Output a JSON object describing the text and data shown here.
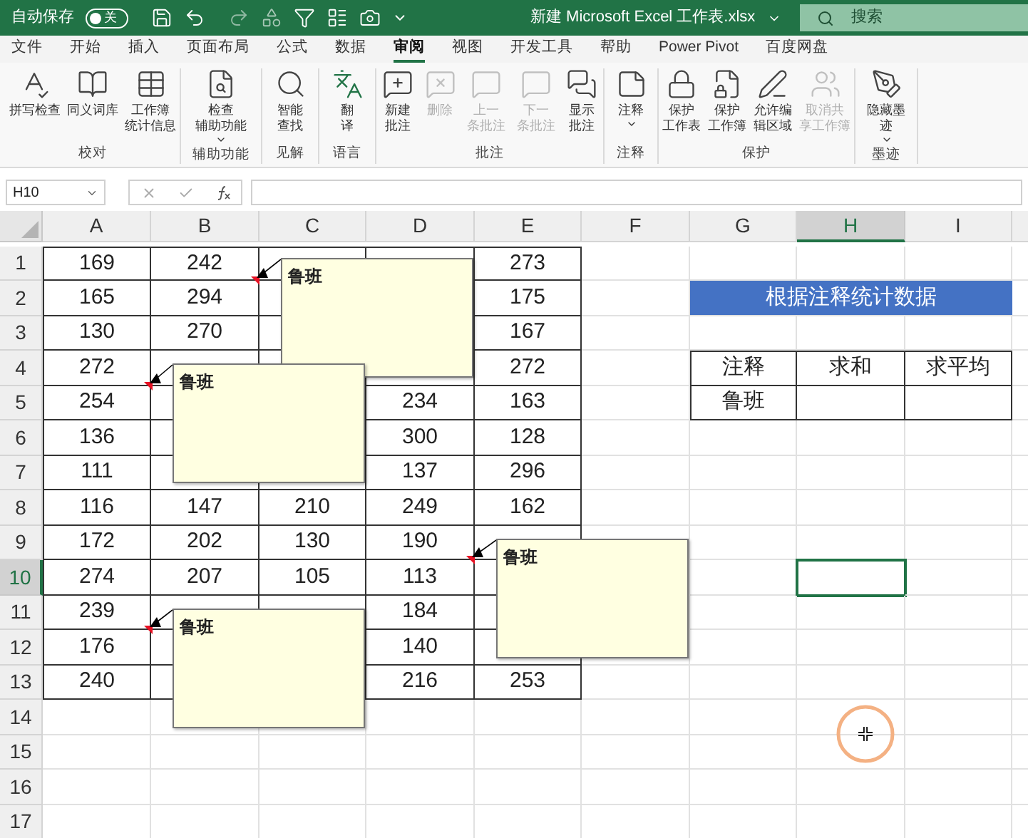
{
  "title_bar": {
    "autosave_label": "自动保存",
    "autosave_toggle": {
      "label": "关",
      "on": false
    },
    "title": "新建 Microsoft Excel 工作表.xlsx",
    "search": {
      "placeholder": "搜索"
    }
  },
  "menu_tabs": [
    {
      "label": "文件",
      "selected": false
    },
    {
      "label": "开始",
      "selected": false
    },
    {
      "label": "插入",
      "selected": false
    },
    {
      "label": "页面布局",
      "selected": false
    },
    {
      "label": "公式",
      "selected": false
    },
    {
      "label": "数据",
      "selected": false
    },
    {
      "label": "审阅",
      "selected": true
    },
    {
      "label": "视图",
      "selected": false
    },
    {
      "label": "开发工具",
      "selected": false
    },
    {
      "label": "帮助",
      "selected": false
    },
    {
      "label": "Power Pivot",
      "selected": false
    },
    {
      "label": "百度网盘",
      "selected": false
    }
  ],
  "ribbon": [
    {
      "label": "校对",
      "buttons": [
        {
          "label": [
            "拼写检查"
          ],
          "disabled": false,
          "dropdown": false
        },
        {
          "label": [
            "同义词库"
          ],
          "disabled": false,
          "dropdown": false
        },
        {
          "label": [
            "工作簿",
            "统计信息"
          ],
          "disabled": false,
          "dropdown": false
        }
      ]
    },
    {
      "label": "辅助功能",
      "buttons": [
        {
          "label": [
            "检查",
            "辅助功能"
          ],
          "disabled": false,
          "dropdown": true
        }
      ]
    },
    {
      "label": "见解",
      "buttons": [
        {
          "label": [
            "智能",
            "查找"
          ],
          "disabled": false,
          "dropdown": false
        }
      ]
    },
    {
      "label": "语言",
      "buttons": [
        {
          "label": [
            "翻",
            "译"
          ],
          "disabled": false,
          "dropdown": false
        }
      ]
    },
    {
      "label": "批注",
      "buttons": [
        {
          "label": [
            "新建",
            "批注"
          ],
          "disabled": false,
          "dropdown": false
        },
        {
          "label": [
            "删除"
          ],
          "disabled": true,
          "dropdown": false
        },
        {
          "label": [
            "上一",
            "条批注"
          ],
          "disabled": true,
          "dropdown": false
        },
        {
          "label": [
            "下一",
            "条批注"
          ],
          "disabled": true,
          "dropdown": false
        },
        {
          "label": [
            "显示",
            "批注"
          ],
          "disabled": false,
          "dropdown": false
        }
      ]
    },
    {
      "label": "注释",
      "buttons": [
        {
          "label": [
            "注释"
          ],
          "disabled": false,
          "dropdown": true
        }
      ]
    },
    {
      "label": "保护",
      "buttons": [
        {
          "label": [
            "保护",
            "工作表"
          ],
          "disabled": false,
          "dropdown": false
        },
        {
          "label": [
            "保护",
            "工作簿"
          ],
          "disabled": false,
          "dropdown": false
        },
        {
          "label": [
            "允许编",
            "辑区域"
          ],
          "disabled": false,
          "dropdown": false
        },
        {
          "label": [
            "取消共",
            "享工作簿"
          ],
          "disabled": true,
          "dropdown": false
        }
      ]
    },
    {
      "label": "墨迹",
      "buttons": [
        {
          "label": [
            "隐藏墨",
            "迹"
          ],
          "disabled": false,
          "dropdown": true
        }
      ]
    }
  ],
  "formula_bar": {
    "name_box": "H10"
  },
  "sheet": {
    "columns": [
      {
        "label": "A",
        "selected": false
      },
      {
        "label": "B",
        "selected": false
      },
      {
        "label": "C",
        "selected": false
      },
      {
        "label": "D",
        "selected": false
      },
      {
        "label": "E",
        "selected": false
      },
      {
        "label": "F",
        "selected": false
      },
      {
        "label": "G",
        "selected": false
      },
      {
        "label": "H",
        "selected": true
      },
      {
        "label": "I",
        "selected": false
      }
    ],
    "rows": [
      {
        "label": "1",
        "selected": false,
        "cells": [
          "169",
          "242",
          null,
          null,
          "273"
        ]
      },
      {
        "label": "2",
        "selected": false,
        "cells": [
          "165",
          "294",
          null,
          null,
          "175"
        ]
      },
      {
        "label": "3",
        "selected": false,
        "cells": [
          "130",
          "270",
          null,
          null,
          "167"
        ]
      },
      {
        "label": "4",
        "selected": false,
        "cells": [
          "272",
          null,
          null,
          null,
          "272"
        ]
      },
      {
        "label": "5",
        "selected": false,
        "cells": [
          "254",
          null,
          null,
          "234",
          "163"
        ]
      },
      {
        "label": "6",
        "selected": false,
        "cells": [
          "136",
          null,
          null,
          "300",
          "128"
        ]
      },
      {
        "label": "7",
        "selected": false,
        "cells": [
          "111",
          null,
          null,
          "137",
          "296"
        ]
      },
      {
        "label": "8",
        "selected": false,
        "cells": [
          "116",
          "147",
          "210",
          "249",
          "162"
        ]
      },
      {
        "label": "9",
        "selected": false,
        "cells": [
          "172",
          "202",
          "130",
          "190",
          null
        ]
      },
      {
        "label": "10",
        "selected": true,
        "cells": [
          "274",
          "207",
          "105",
          "113",
          null
        ]
      },
      {
        "label": "11",
        "selected": false,
        "cells": [
          "239",
          null,
          null,
          "184",
          null
        ]
      },
      {
        "label": "12",
        "selected": false,
        "cells": [
          "176",
          null,
          null,
          "140",
          null
        ]
      },
      {
        "label": "13",
        "selected": false,
        "cells": [
          "240",
          null,
          null,
          "216",
          "253"
        ]
      },
      {
        "label": "14",
        "selected": false
      },
      {
        "label": "15",
        "selected": false
      },
      {
        "label": "16",
        "selected": false
      },
      {
        "label": "17",
        "selected": false
      }
    ],
    "comments": [
      {
        "author": "鲁班"
      },
      {
        "author": "鲁班"
      },
      {
        "author": "鲁班"
      },
      {
        "author": "鲁班"
      }
    ]
  },
  "summary": {
    "banner": "根据注释统计数据",
    "columns": [
      "注释",
      "求和",
      "求平均"
    ],
    "rows": [
      [
        "鲁班"
      ]
    ]
  }
}
